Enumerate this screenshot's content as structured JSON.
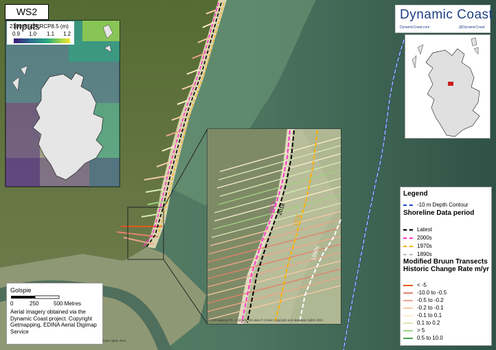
{
  "title": "WS2 Inputs",
  "logo": {
    "name": "Dynamic Coast",
    "site": "DynamicCoast.com",
    "handle": "@DynamicCoast"
  },
  "rslr_inset": {
    "title": "2100 RSLR RCP8.5 (m)",
    "ticks": [
      "0.9",
      "1.0",
      "1.1",
      "1.2"
    ],
    "colors": [
      "#3b1778",
      "#2c6f8e",
      "#29a981",
      "#a9d945",
      "#f9e528"
    ]
  },
  "place_label": "Golspie",
  "scalebar": {
    "ticks": [
      "0",
      "250",
      "500 Metres"
    ]
  },
  "imagery_credit": "Aerial imagery obtained via the Dynamic Coast project. Copyright Getmapping, EDINA Aerial Digimap Service",
  "map_credit": "© Getmapping Plc. Contains OS data © Crown copyright and database rights 2021",
  "map_credit_small": "base rights 2021",
  "shoreline_labels": [
    {
      "text": "2013",
      "color": "#e040c0"
    },
    {
      "text": "2018",
      "color": "#000000"
    },
    {
      "text": "1970",
      "color": "#f0a000"
    },
    {
      "text": "1890s",
      "color": "#ffffff"
    }
  ],
  "legend": {
    "title": "Legend",
    "depth_contour": {
      "label": "-10 m Depth Contour",
      "color": "#2244cc"
    },
    "shoreline": {
      "heading": "Shoreline Data period",
      "items": [
        {
          "label": "Latest",
          "color": "#000000"
        },
        {
          "label": "2000s",
          "color": "#ff33cc"
        },
        {
          "label": "1970s",
          "color": "#ffb000"
        },
        {
          "label": "1890s",
          "color": "#bbbbbb"
        }
      ]
    },
    "transects": {
      "heading": "Modified Bruun Transects Historic Change Rate m/yr",
      "items": [
        {
          "label": "< -5",
          "color": "#e8571f"
        },
        {
          "label": "-10.0 to -0.5",
          "color": "#e2826a"
        },
        {
          "label": "-0.5 to -0.2",
          "color": "#eea58a"
        },
        {
          "label": "-0.2 to -0.1",
          "color": "#f5caa5"
        },
        {
          "label": "-0.1 to 0.1",
          "color": "#fbeec9"
        },
        {
          "label": "0.1 to 0.2",
          "color": "#d6eab4"
        },
        {
          "label": "> 5",
          "color": "#9fd27f"
        },
        {
          "label": "0.5 to 10.0",
          "color": "#4aa54a"
        }
      ]
    }
  }
}
